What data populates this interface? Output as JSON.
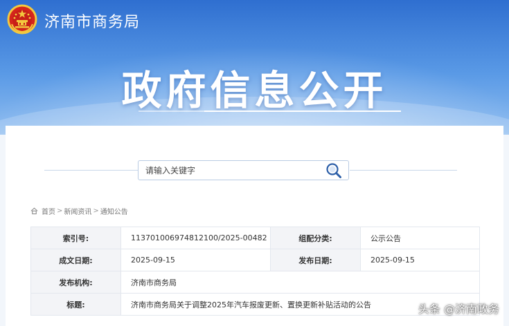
{
  "header": {
    "site_name": "济南市商务局",
    "hero_title": "政府信息公开"
  },
  "search": {
    "placeholder": "请输入关键字"
  },
  "breadcrumb": {
    "items": [
      "首页",
      "新闻资讯",
      "通知公告"
    ],
    "separator": ">"
  },
  "info_table": {
    "rows": [
      {
        "label1": "索引号:",
        "value1": "113701006974812100/2025-00482",
        "label2": "组配分类:",
        "value2": "公示公告"
      },
      {
        "label1": "成文日期:",
        "value1": "2025-09-15",
        "label2": "发布日期:",
        "value2": "2025-09-15"
      },
      {
        "label1": "发布机构:",
        "value1": "济南市商务局"
      },
      {
        "label1": "标题:",
        "value1": "济南市商务局关于调整2025年汽车报废更新、置换更新补贴活动的公告"
      }
    ]
  },
  "watermark": "头条 @济南政务",
  "colors": {
    "banner_top": "#2f6fd0",
    "banner_bottom": "#8fbdf0",
    "label_bg": "#f3f4f7",
    "border": "#e3e7ee"
  },
  "icons": [
    "national-emblem-icon",
    "search-icon",
    "home-icon"
  ]
}
